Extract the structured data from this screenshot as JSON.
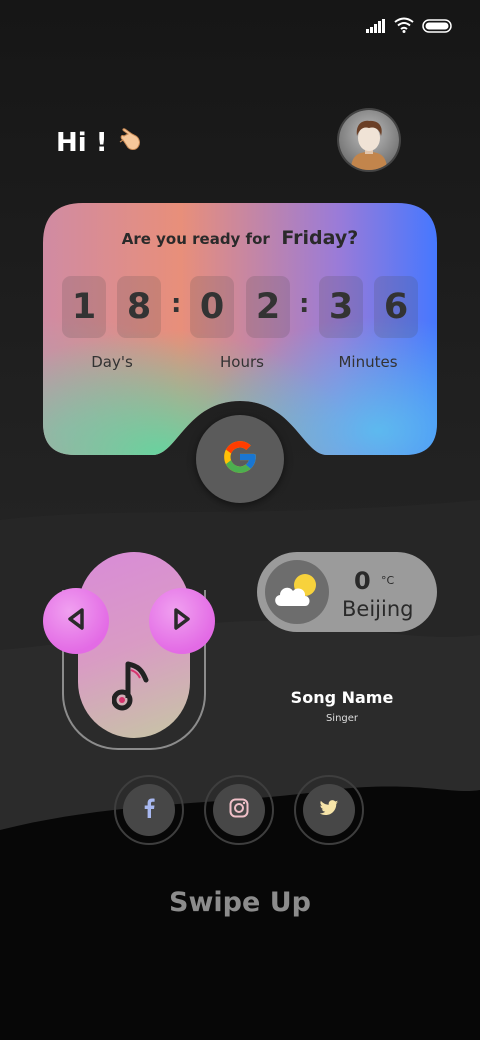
{
  "status": {
    "icons": [
      "signal-icon",
      "wifi-icon",
      "battery-icon"
    ]
  },
  "greeting": {
    "text": "Hi !",
    "icon": "call-me-hand-icon"
  },
  "avatar": {
    "icon": "user-avatar"
  },
  "countdown": {
    "prefix": "Are you ready for",
    "day": "Friday?",
    "digits": [
      "1",
      "8",
      "0",
      "2",
      "3",
      "6"
    ],
    "separator": ":",
    "labels": [
      "Day's",
      "Hours",
      "Minutes"
    ]
  },
  "google": {
    "icon": "google-icon"
  },
  "music": {
    "prev_icon": "chevron-left-icon",
    "next_icon": "chevron-right-icon",
    "note_icon": "music-note-icon",
    "song_name": "Song Name",
    "singer": "Singer"
  },
  "weather": {
    "temp": "0",
    "unit": "°C",
    "city": "Beijing",
    "icon": "partly-cloudy-icon"
  },
  "social": [
    "facebook-icon",
    "instagram-icon",
    "twitter-icon"
  ],
  "footer": {
    "swipe": "Swipe Up"
  },
  "colors": {
    "accent_pink": "#e36be5",
    "card_gradient": [
      "#e8707a",
      "#4a78ff",
      "#62d3a4"
    ],
    "background": "#1c1c1c"
  }
}
